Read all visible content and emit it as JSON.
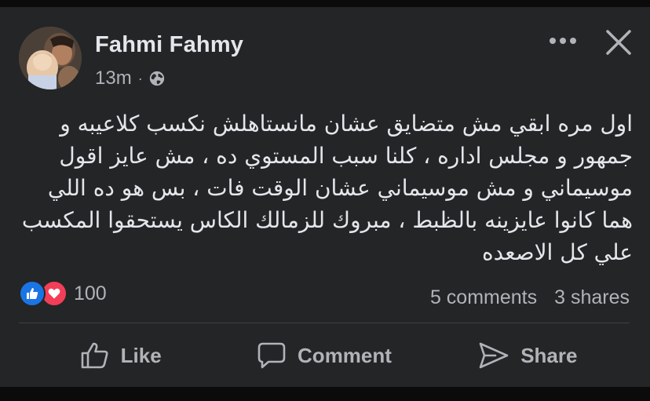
{
  "post": {
    "author": "Fahmi Fahmy",
    "time": "13m",
    "separator": "·",
    "privacy_icon": "globe-icon",
    "text": "اول مره ابقي مش متضايق عشان مانستاهلش نكسب كلاعيبه و جمهور و مجلس اداره ، كلنا سبب المستوي ده ، مش عايز اقول موسيماني و مش موسيماني عشان الوقت فات ، بس هو ده اللي هما كانوا عايزينه بالظبط ، مبروك للزمالك الكاس يستحقوا المكسب علي كل الاصعده"
  },
  "reactions": {
    "icons": [
      "like-reaction-icon",
      "love-reaction-icon"
    ],
    "count": "100",
    "comments": "5 comments",
    "shares": "3 shares"
  },
  "actions": {
    "like": "Like",
    "comment": "Comment",
    "share": "Share"
  },
  "colors": {
    "background": "#0b0b0c",
    "card": "#242526",
    "text_primary": "#e4e6eb",
    "text_secondary": "#b0b3b8",
    "like_blue": "#1b74e4",
    "love_red": "#f33e58"
  }
}
